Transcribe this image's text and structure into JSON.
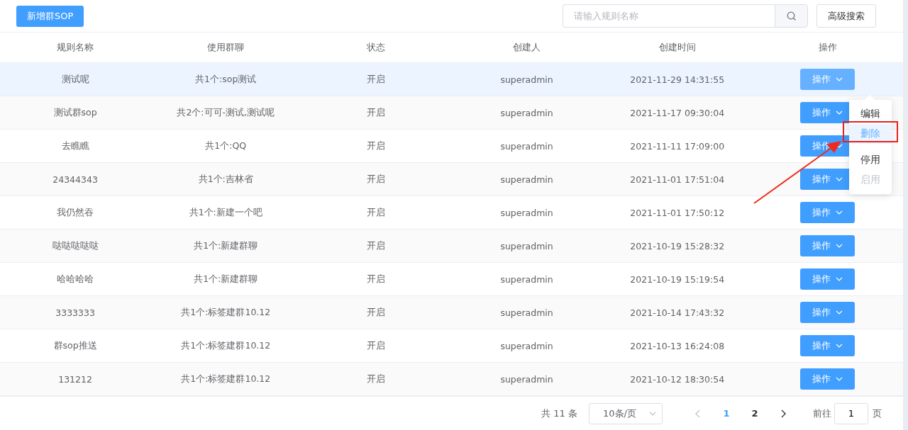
{
  "toolbar": {
    "add_button": "新增群SOP",
    "search": {
      "placeholder": "请输入规则名称"
    },
    "advanced_button": "高级搜索"
  },
  "table": {
    "columns": [
      "规则名称",
      "使用群聊",
      "状态",
      "创建人",
      "创建时间",
      "操作"
    ],
    "rows": [
      {
        "name": "测试呢",
        "groups": "共1个:sop测试",
        "status": "开启",
        "creator": "superadmin",
        "created": "2021-11-29 14:31:55",
        "action": "操作",
        "hovered": true,
        "menu_open": true
      },
      {
        "name": "测试群sop",
        "groups": "共2个:可可-测试,测试呢",
        "status": "开启",
        "creator": "superadmin",
        "created": "2021-11-17 09:30:04",
        "action": "操作",
        "hovered": false,
        "menu_open": false
      },
      {
        "name": "去瞧瞧",
        "groups": "共1个:QQ",
        "status": "开启",
        "creator": "superadmin",
        "created": "2021-11-11 17:09:00",
        "action": "操作",
        "hovered": false,
        "menu_open": false
      },
      {
        "name": "24344343",
        "groups": "共1个:吉林省",
        "status": "开启",
        "creator": "superadmin",
        "created": "2021-11-01 17:51:04",
        "action": "操作",
        "hovered": false,
        "menu_open": false
      },
      {
        "name": "我仍然吞",
        "groups": "共1个:新建一个吧",
        "status": "开启",
        "creator": "superadmin",
        "created": "2021-11-01 17:50:12",
        "action": "操作",
        "hovered": false,
        "menu_open": false
      },
      {
        "name": "哒哒哒哒哒",
        "groups": "共1个:新建群聊",
        "status": "开启",
        "creator": "superadmin",
        "created": "2021-10-19 15:28:32",
        "action": "操作",
        "hovered": false,
        "menu_open": false
      },
      {
        "name": "哈哈哈哈",
        "groups": "共1个:新建群聊",
        "status": "开启",
        "creator": "superadmin",
        "created": "2021-10-19 15:19:54",
        "action": "操作",
        "hovered": false,
        "menu_open": false
      },
      {
        "name": "3333333",
        "groups": "共1个:标签建群10.12",
        "status": "开启",
        "creator": "superadmin",
        "created": "2021-10-14 17:43:32",
        "action": "操作",
        "hovered": false,
        "menu_open": false
      },
      {
        "name": "群sop推送",
        "groups": "共1个:标签建群10.12",
        "status": "开启",
        "creator": "superadmin",
        "created": "2021-10-13 16:24:08",
        "action": "操作",
        "hovered": false,
        "menu_open": false
      },
      {
        "name": "131212",
        "groups": "共1个:标签建群10.12",
        "status": "开启",
        "creator": "superadmin",
        "created": "2021-10-12 18:30:54",
        "action": "操作",
        "hovered": false,
        "menu_open": false
      }
    ]
  },
  "action_menu": [
    {
      "label": "编辑",
      "highlighted": false,
      "disabled": false,
      "divided": false,
      "annotated": false
    },
    {
      "label": "删除",
      "highlighted": true,
      "disabled": false,
      "divided": false,
      "annotated": true
    },
    {
      "label": "停用",
      "highlighted": false,
      "disabled": false,
      "divided": true,
      "annotated": false
    },
    {
      "label": "启用",
      "highlighted": false,
      "disabled": true,
      "divided": false,
      "annotated": false
    }
  ],
  "pagination": {
    "total": "共 11 条",
    "page_size": "10条/页",
    "prev_disabled": true,
    "pages": [
      {
        "label": "1",
        "selected": true
      },
      {
        "label": "2",
        "selected": false
      }
    ],
    "goto_label": "前往",
    "goto_value": "1",
    "page_suffix": "页"
  }
}
